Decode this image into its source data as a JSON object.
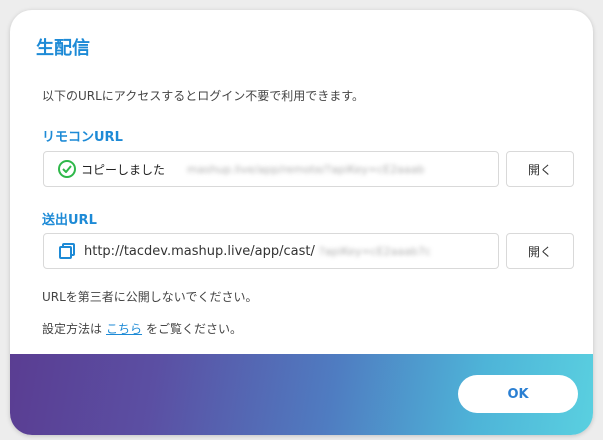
{
  "dialog": {
    "title": "生配信",
    "description": "以下のURLにアクセスするとログイン不要で利用できます。"
  },
  "remote": {
    "label": "リモコンURL",
    "copied_text": "コピーしました",
    "blurred_url": "mashup.live/app/remote/?apiKey=cE2aaab",
    "open_label": "開く"
  },
  "cast": {
    "label": "送出URL",
    "url_text": "http://tacdev.mashup.live/app/cast/",
    "blurred_url": "?apiKey=cE2aaab7c",
    "open_label": "開く"
  },
  "notes": {
    "warning": "URLを第三者に公開しないでください。",
    "howto_prefix": "設定方法は",
    "howto_link": "こちら",
    "howto_suffix": "をご覧ください。"
  },
  "footer": {
    "ok_label": "OK"
  },
  "colors": {
    "accent": "#1d8ad6",
    "success": "#2fb84a"
  },
  "icons": {
    "check": "check-circle-icon",
    "copy": "copy-icon"
  }
}
